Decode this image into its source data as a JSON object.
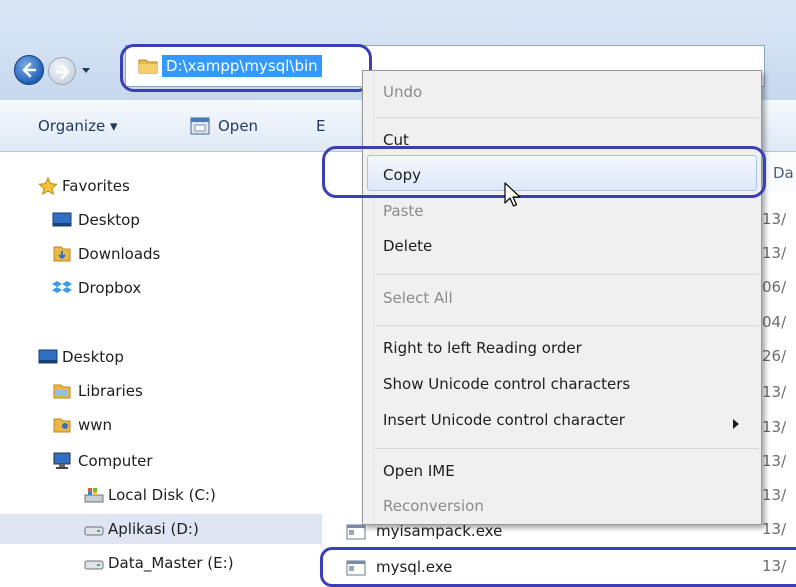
{
  "address": {
    "path": "D:\\xampp\\mysql\\bin"
  },
  "toolbar": {
    "organize": "Organize ▾",
    "open": "Open",
    "third": "E"
  },
  "navpane": {
    "items": [
      {
        "label": "Favorites",
        "icon": "star-icon"
      },
      {
        "label": "Desktop",
        "icon": "desktop-icon"
      },
      {
        "label": "Downloads",
        "icon": "downloads-folder-icon"
      },
      {
        "label": "Dropbox",
        "icon": "dropbox-icon"
      },
      {
        "label": "Desktop",
        "icon": "desktop-icon"
      },
      {
        "label": "Libraries",
        "icon": "libraries-icon"
      },
      {
        "label": "wwn",
        "icon": "user-folder-icon"
      },
      {
        "label": "Computer",
        "icon": "computer-icon"
      },
      {
        "label": "Local Disk (C:)",
        "icon": "system-drive-icon"
      },
      {
        "label": "Aplikasi (D:)",
        "icon": "drive-icon"
      },
      {
        "label": "Data_Master (E:)",
        "icon": "drive-icon"
      }
    ]
  },
  "filelist": {
    "date_header": "Da",
    "dates": [
      "13/",
      "13/",
      "06/",
      "04/",
      "26/",
      "13/",
      "13/",
      "13/",
      "13/",
      "13/",
      "13/"
    ],
    "files": [
      {
        "name": "myisampack.exe"
      },
      {
        "name": "mysql.exe"
      }
    ]
  },
  "context_menu": {
    "items": [
      {
        "label": "Undo",
        "disabled": true
      },
      {
        "label": "Cut",
        "disabled": false
      },
      {
        "label": "Copy",
        "disabled": false
      },
      {
        "label": "Paste",
        "disabled": true
      },
      {
        "label": "Delete",
        "disabled": false
      },
      {
        "label": "Select All",
        "disabled": true
      },
      {
        "label": "Right to left Reading order",
        "disabled": false
      },
      {
        "label": "Show Unicode control characters",
        "disabled": false
      },
      {
        "label": "Insert Unicode control character",
        "disabled": false
      },
      {
        "label": "Open IME",
        "disabled": false
      },
      {
        "label": "Reconversion",
        "disabled": true
      }
    ]
  },
  "colors": {
    "highlight_ring": "#3b3fb7",
    "selection": "#3399ff",
    "menu_bg": "#f0f0f0"
  }
}
